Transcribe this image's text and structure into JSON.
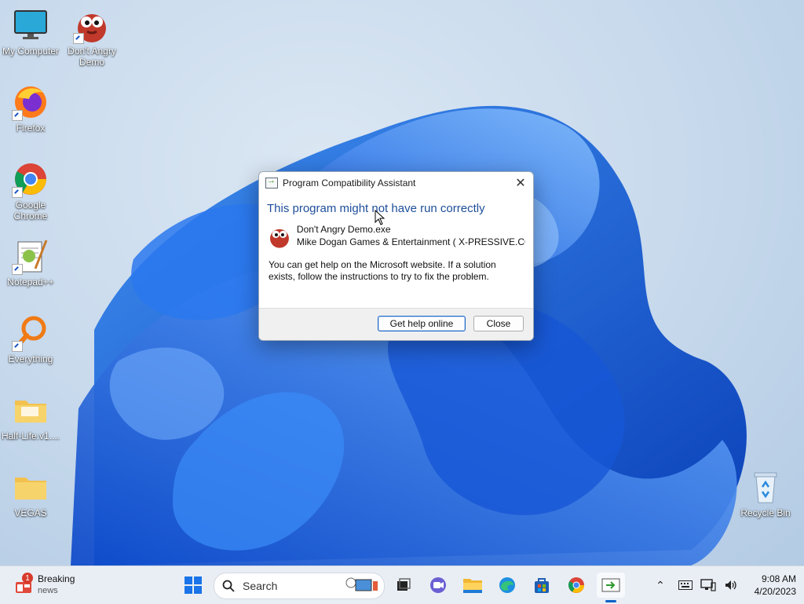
{
  "desktop": {
    "icons": [
      {
        "label": "My Computer",
        "icon": "monitor-icon"
      },
      {
        "label": "Don't Angry Demo",
        "icon": "red-bird-icon"
      },
      {
        "label": "Firefox",
        "icon": "firefox-icon"
      },
      {
        "label": "Google Chrome",
        "icon": "chrome-icon"
      },
      {
        "label": "Notepad++",
        "icon": "notepadpp-icon"
      },
      {
        "label": "Everything",
        "icon": "magnifier-icon"
      },
      {
        "label": "Half-Life.v1....",
        "icon": "folder-icon"
      },
      {
        "label": "VEGAS",
        "icon": "folder-icon"
      },
      {
        "label": "Recycle Bin",
        "icon": "recycle-bin-icon"
      }
    ]
  },
  "dialog": {
    "title": "Program Compatibility Assistant",
    "close_glyph": "✕",
    "heading": "This program might not have run correctly",
    "app_name": "Don't Angry Demo.exe",
    "publisher": "Mike Dogan Games & Entertainment ( X-PRESSIVE.COM )",
    "message": "You can get help on the Microsoft website.  If a solution exists, follow the instructions to try to fix the problem.",
    "primary_button": "Get help online",
    "close_button": "Close"
  },
  "taskbar": {
    "widget_title": "Breaking",
    "widget_subtitle": "news",
    "widget_badge": "1",
    "search_placeholder": "Search",
    "time": "9:08 AM",
    "date": "4/20/2023",
    "tray_overflow_glyph": "⌃"
  },
  "colors": {
    "accent": "#0b62c7",
    "heading": "#1e4e9a",
    "taskbar": "#e9eef5"
  }
}
